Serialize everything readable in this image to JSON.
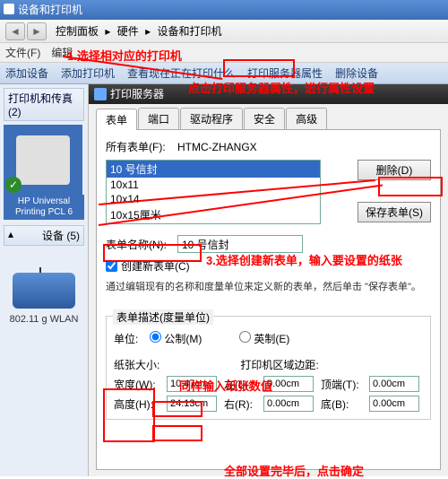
{
  "window_title": "设备和打印机",
  "nav": {
    "back": "◄",
    "fwd": "►",
    "crumb1": "控制面板",
    "crumb2": "硬件",
    "crumb3": "设备和打印机",
    "sep": "▸"
  },
  "filebar": {
    "file": "文件(F)",
    "edit": "编辑"
  },
  "cmdbar": {
    "add_device": "添加设备",
    "add_printer": "添加打印机",
    "view_queue": "查看现在正在打印什么",
    "server_props": "打印服务器属性",
    "remove": "删除设备"
  },
  "sidebar": {
    "header": "打印机和传真 (2)",
    "printer_name": "HP Universal Printing PCL 6",
    "check": "✓",
    "devices_hdr": "设备 (5)",
    "devices_arrow": "▴",
    "wlan": "802.11 g WLAN"
  },
  "dialog": {
    "title": "打印服务器",
    "tabs": {
      "forms": "表单",
      "ports": "端口",
      "drivers": "驱动程序",
      "security": "安全",
      "advanced": "高级"
    },
    "all_forms_label": "所有表单(F):",
    "server_name": "HTMC-ZHANGX",
    "forms_list": [
      "10 号信封",
      "10x11",
      "10x14",
      "10x15厘米"
    ],
    "delete_btn": "删除(D)",
    "save_btn": "保存表单(S)",
    "form_name_label": "表单名称(N):",
    "form_name_value": "10 号信封",
    "create_new": "创建新表单(C)",
    "create_hint": "通过编辑现有的名称和度量单位来定义新的表单，然后单击 \"保存表单\"。",
    "desc_label": "表单描述(度量单位)",
    "unit_label": "单位:",
    "unit_metric": "公制(M)",
    "unit_english": "英制(E)",
    "size_label": "纸张大小:",
    "margin_label": "打印机区域边距:",
    "width_l": "宽度(W):",
    "width_v": "10.47cm",
    "height_l": "高度(H):",
    "height_v": "24.13cm",
    "left_l": "左(L):",
    "left_v": "0.00cm",
    "right_l": "右(R):",
    "right_v": "0.00cm",
    "top_l": "顶端(T):",
    "top_v": "0.00cm",
    "bottom_l": "底(B):",
    "bottom_v": "0.00cm"
  },
  "annotations": {
    "a1": "1.选择相对应的打印机",
    "a2": "点击打印服务器属性，进行属性设置",
    "a3": "3.选择创建新表单，输入要设置的纸张",
    "a4": "同样输入纸张数值",
    "a5": "全部设置完毕后，点击确定"
  }
}
